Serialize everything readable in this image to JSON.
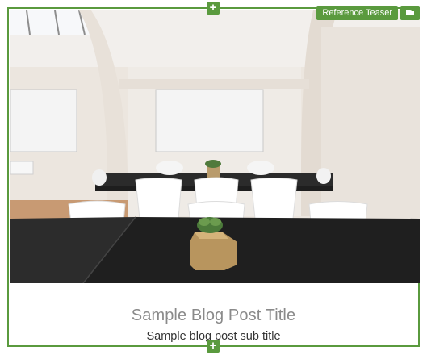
{
  "component": {
    "label": "Reference Teaser",
    "accent_color": "#5a9a3e"
  },
  "teaser": {
    "title": "Sample Blog Post Title",
    "subtitle": "Sample blog post sub title",
    "image": "conference-room-photo"
  },
  "controls": {
    "add_top_symbol": "+",
    "add_bottom_symbol": "+",
    "action_icon": "paragraph-icon"
  }
}
